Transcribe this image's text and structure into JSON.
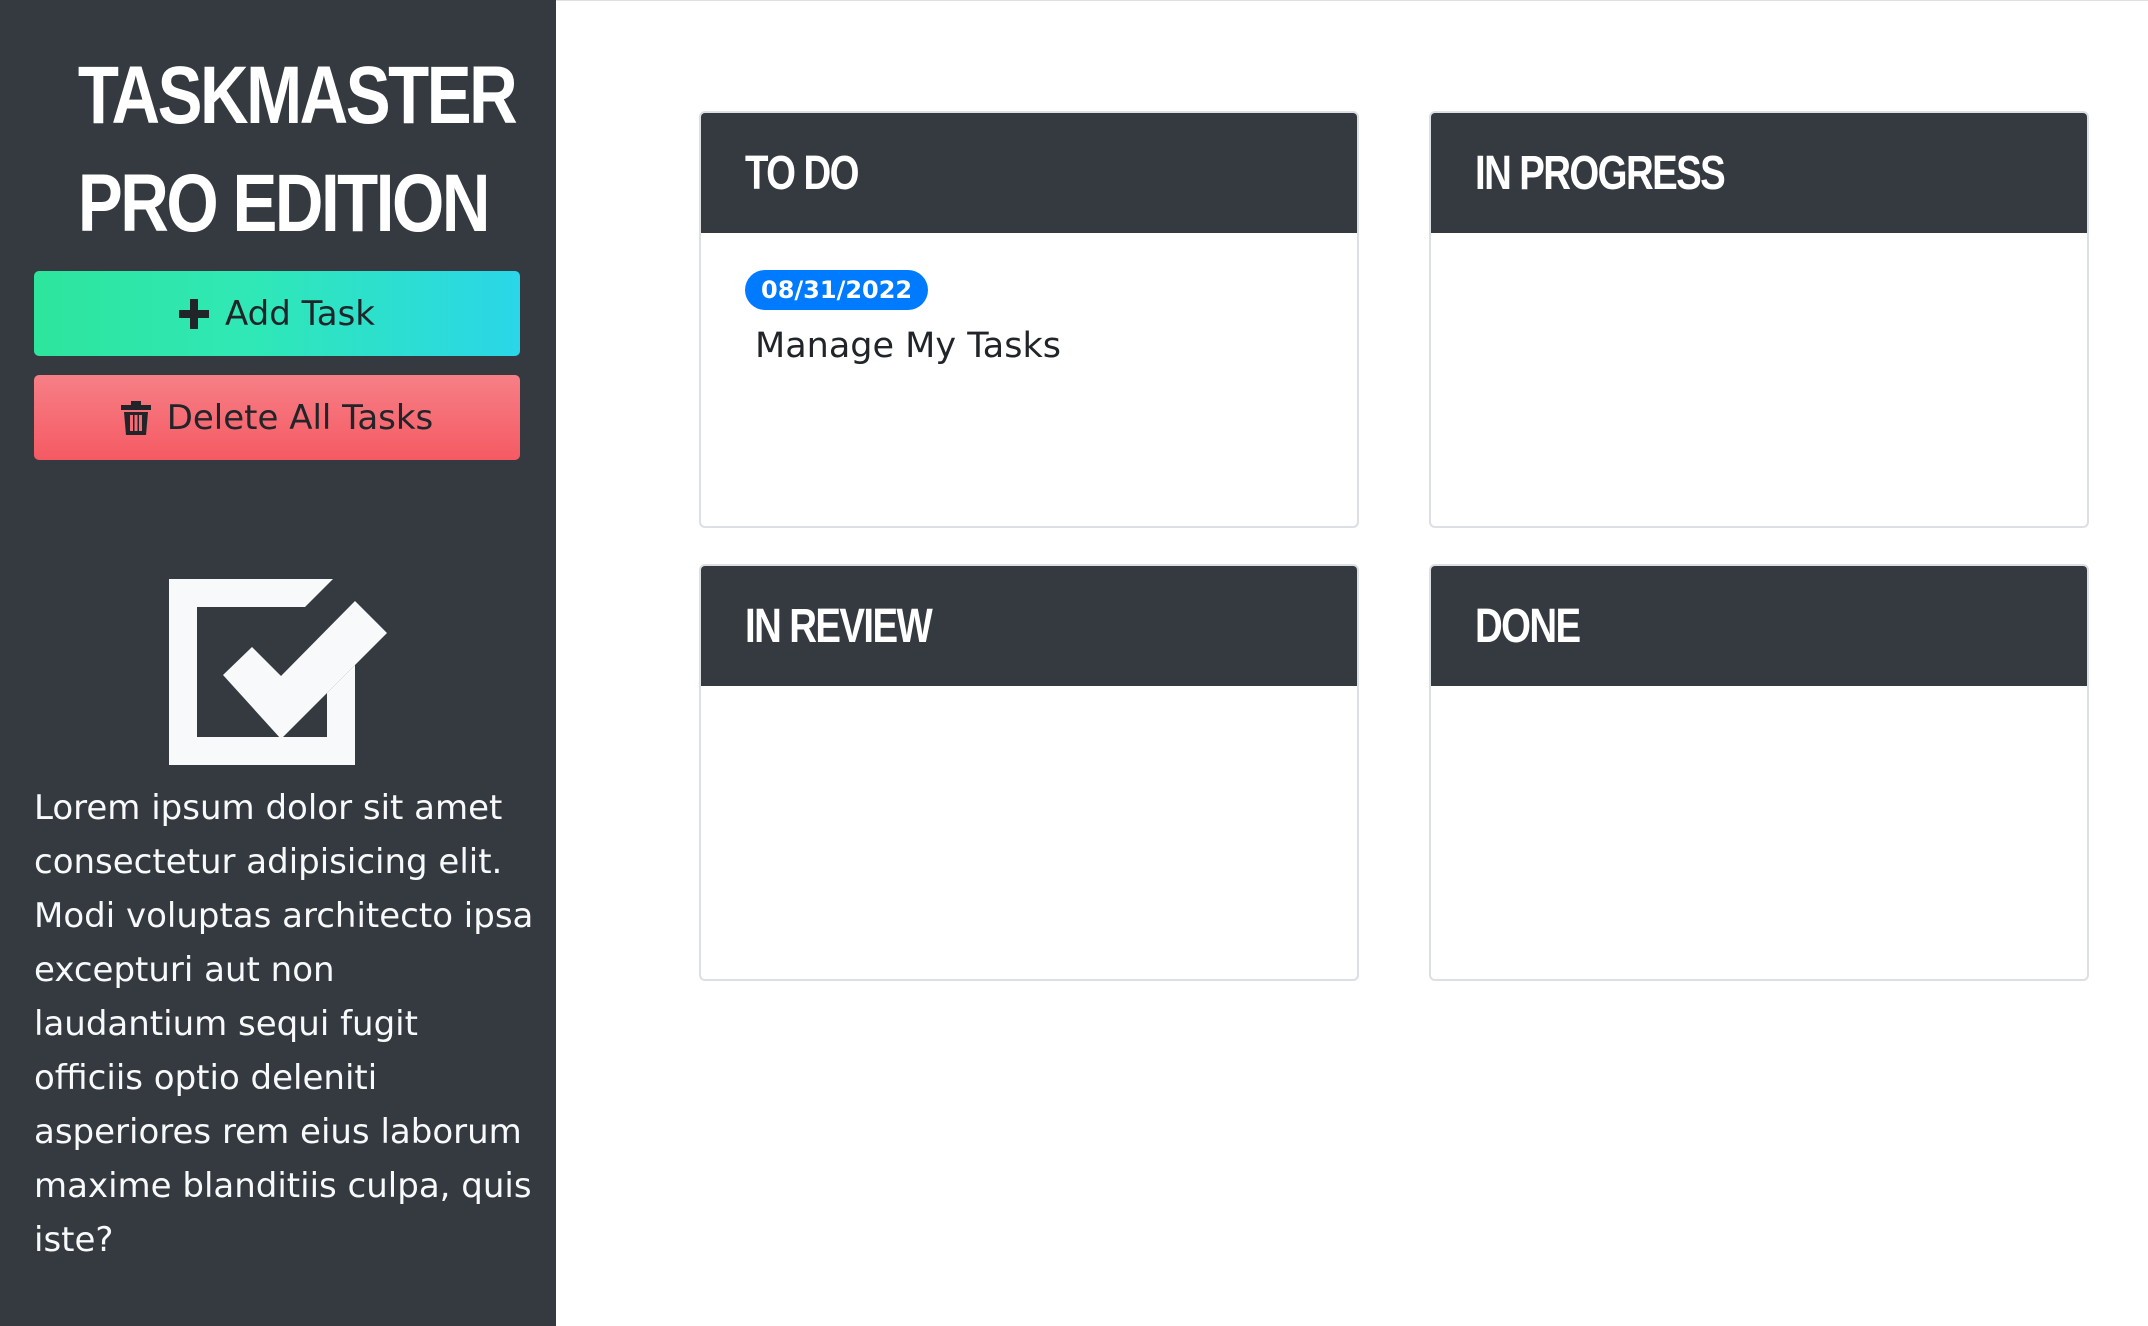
{
  "sidebar": {
    "title_line1": "TASKMASTER",
    "title_line2": "PRO EDITION",
    "add_button_label": "Add Task",
    "delete_button_label": "Delete All Tasks",
    "about_text": "Lorem ipsum dolor sit amet consectetur adipisicing elit. Modi voluptas architecto ipsa excepturi aut non laudantium sequi fugit officiis optio deleniti asperiores rem eius laborum maxime blanditiis culpa, quis iste?",
    "logo_icon": "check-square-icon"
  },
  "board": {
    "columns": [
      {
        "title": "TO DO",
        "tasks": [
          {
            "due_date": "08/31/2022",
            "title": "Manage My Tasks"
          }
        ]
      },
      {
        "title": "IN PROGRESS",
        "tasks": []
      },
      {
        "title": "IN REVIEW",
        "tasks": []
      },
      {
        "title": "DONE",
        "tasks": []
      }
    ]
  },
  "colors": {
    "sidebar_bg": "#343a40",
    "header_bg": "#343a40",
    "badge_bg": "#007bff",
    "add_gradient_start": "#2ee59d",
    "add_gradient_end": "#2ad6e8",
    "delete_bg": "#f66a72"
  }
}
